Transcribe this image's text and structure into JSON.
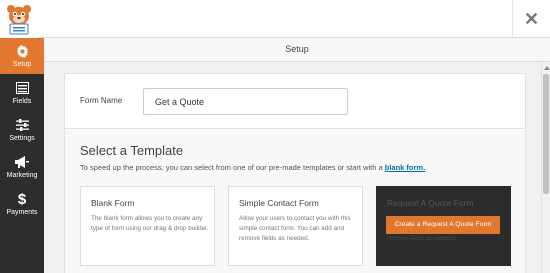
{
  "header": {
    "logo_icon": "wpforms-bear-icon",
    "close_label": "✕"
  },
  "sidebar": {
    "items": [
      {
        "label": "Setup",
        "icon": "gear-icon",
        "active": true
      },
      {
        "label": "Fields",
        "icon": "fields-list-icon",
        "active": false
      },
      {
        "label": "Settings",
        "icon": "sliders-icon",
        "active": false
      },
      {
        "label": "Marketing",
        "icon": "megaphone-icon",
        "active": false
      },
      {
        "label": "Payments",
        "icon": "dollar-icon",
        "active": false
      }
    ]
  },
  "setup_bar": {
    "title": "Setup"
  },
  "form_name": {
    "label": "Form Name",
    "value": "Get a Quote"
  },
  "template_section": {
    "title": "Select a Template",
    "description": "To speed up the process, you can select from one of our pre-made templates or start with a",
    "link_text": "blank form."
  },
  "cards": [
    {
      "title": "Blank Form",
      "description": "The blank form allows you to create any type of form using our drag & drop builder."
    },
    {
      "title": "Simple Contact Form",
      "description": "Allow your users to contact you with this simple contact form. You can add and remove fields as needed."
    },
    {
      "title": "Request A Quote Form",
      "description": "Start collecting leads with this pre-made Request a quote form. You can add and remove fields as needed.",
      "button_label": "Create a Request A Quote Form"
    }
  ],
  "colors": {
    "accent": "#e27730",
    "sidebar_bg": "#2d2d2d",
    "link": "#0073aa"
  }
}
